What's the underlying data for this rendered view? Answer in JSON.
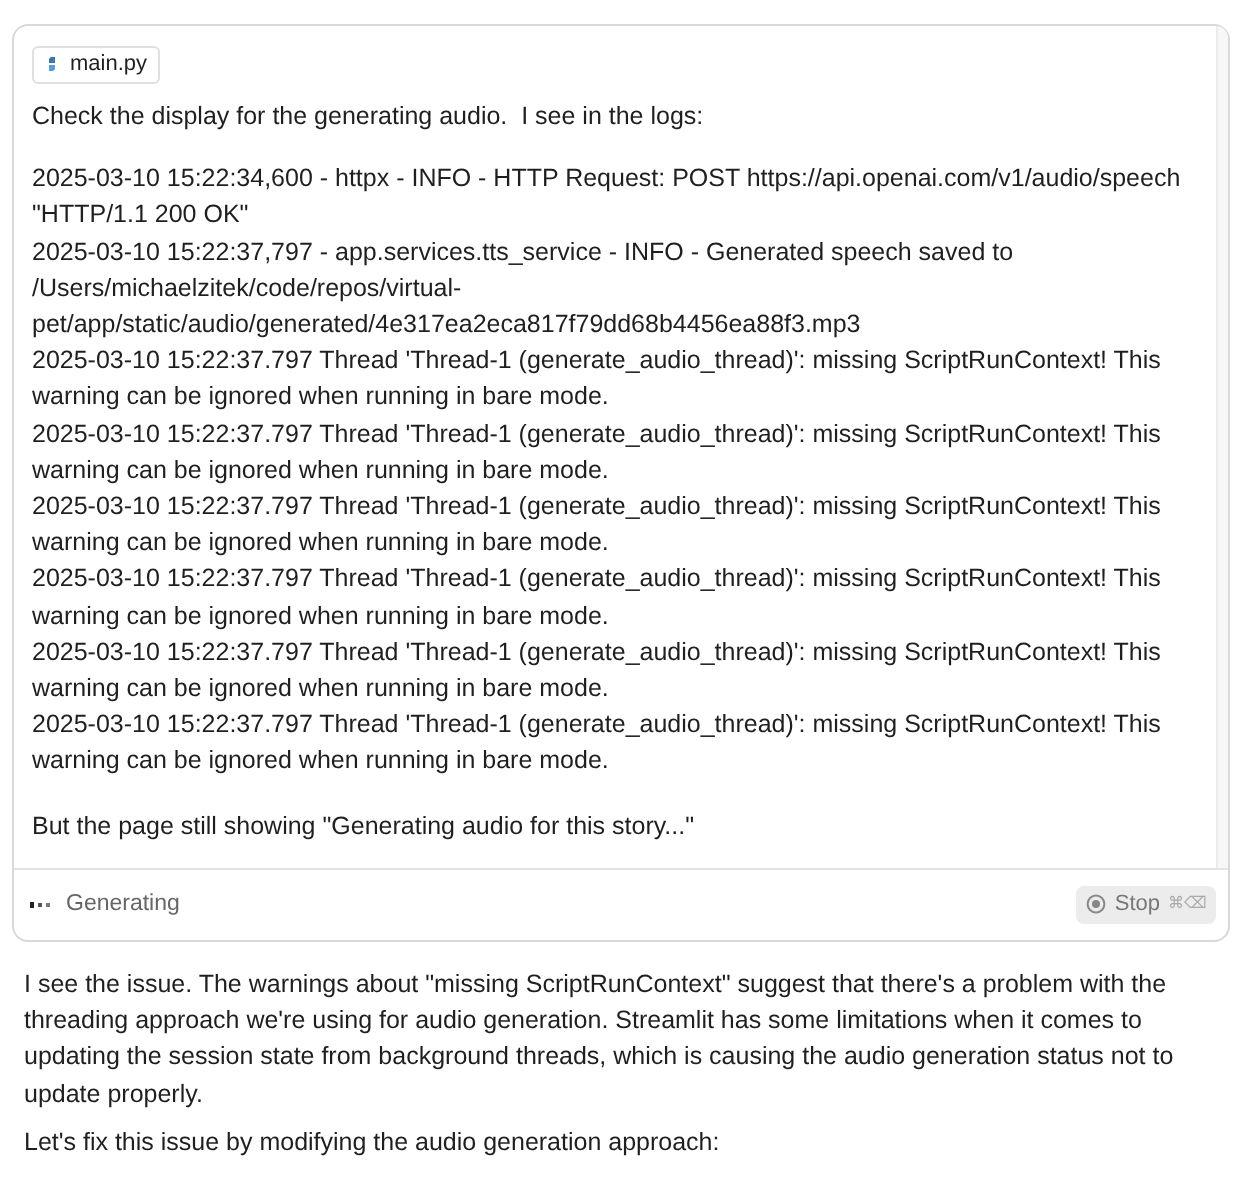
{
  "attachment": {
    "filename": "main.py"
  },
  "message": {
    "intro": "Check the display for the generating audio.  I see in the logs:",
    "log_lines": [
      "2025-03-10 15:22:34,600 - httpx - INFO - HTTP Request: POST https://api.openai.com/v1/audio/speech \"HTTP/1.1 200 OK\"",
      "2025-03-10 15:22:37,797 - app.services.tts_service - INFO - Generated speech saved to /Users/michaelzitek/code/repos/virtual-pet/app/static/audio/generated/4e317ea2eca817f79dd68b4456ea88f3.mp3",
      "2025-03-10 15:22:37.797 Thread 'Thread-1 (generate_audio_thread)': missing ScriptRunContext! This warning can be ignored when running in bare mode.",
      "2025-03-10 15:22:37.797 Thread 'Thread-1 (generate_audio_thread)': missing ScriptRunContext! This warning can be ignored when running in bare mode.",
      "2025-03-10 15:22:37.797 Thread 'Thread-1 (generate_audio_thread)': missing ScriptRunContext! This warning can be ignored when running in bare mode.",
      "2025-03-10 15:22:37.797 Thread 'Thread-1 (generate_audio_thread)': missing ScriptRunContext! This warning can be ignored when running in bare mode.",
      "2025-03-10 15:22:37.797 Thread 'Thread-1 (generate_audio_thread)': missing ScriptRunContext! This warning can be ignored when running in bare mode.",
      "2025-03-10 15:22:37.797 Thread 'Thread-1 (generate_audio_thread)': missing ScriptRunContext! This warning can be ignored when running in bare mode."
    ],
    "outro": "But the page still showing \"Generating audio for this story...\""
  },
  "status": {
    "label": "Generating",
    "stop_button": "Stop",
    "shortcut": "⌘⌫"
  },
  "response": [
    "I see the issue. The warnings about \"missing ScriptRunContext\" suggest that there's a problem with the threading approach we're using for audio generation. Streamlit has some limitations when it comes to updating the session state from background threads, which is causing the audio generation status not to update properly.",
    "Let's fix this issue by modifying the audio generation approach:"
  ]
}
